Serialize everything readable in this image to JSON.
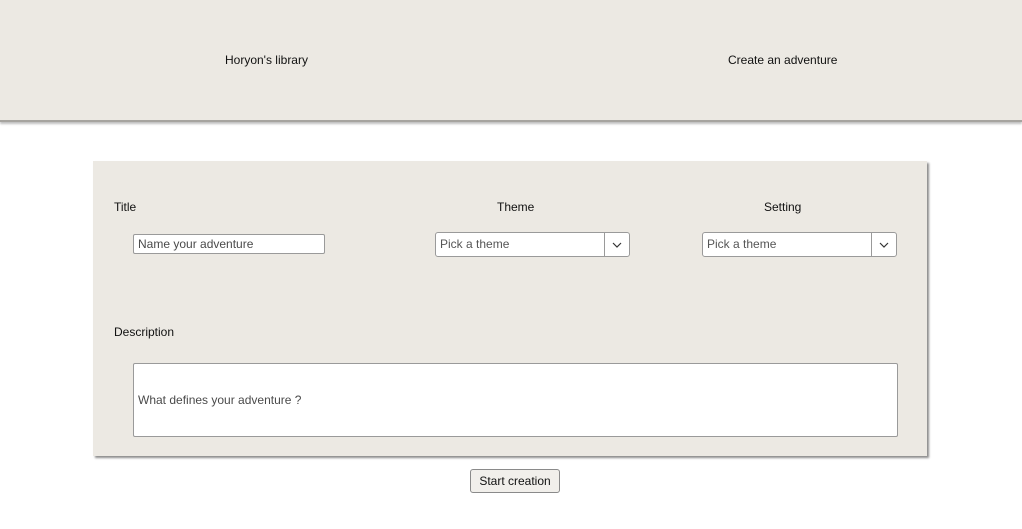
{
  "nav": {
    "library_label": "Horyon's library",
    "create_label": "Create an adventure"
  },
  "form": {
    "title_label": "Title",
    "title_placeholder": "Name your adventure",
    "theme_label": "Theme",
    "theme_placeholder": "Pick a theme",
    "setting_label": "Setting",
    "setting_placeholder": "Pick a theme",
    "description_label": "Description",
    "description_placeholder": "What defines your adventure ?"
  },
  "actions": {
    "start_label": "Start creation"
  },
  "icons": {
    "dropdown": "chevron-down-icon"
  },
  "colors": {
    "panel_bg": "#ece9e3",
    "page_bg": "#ffffff"
  }
}
